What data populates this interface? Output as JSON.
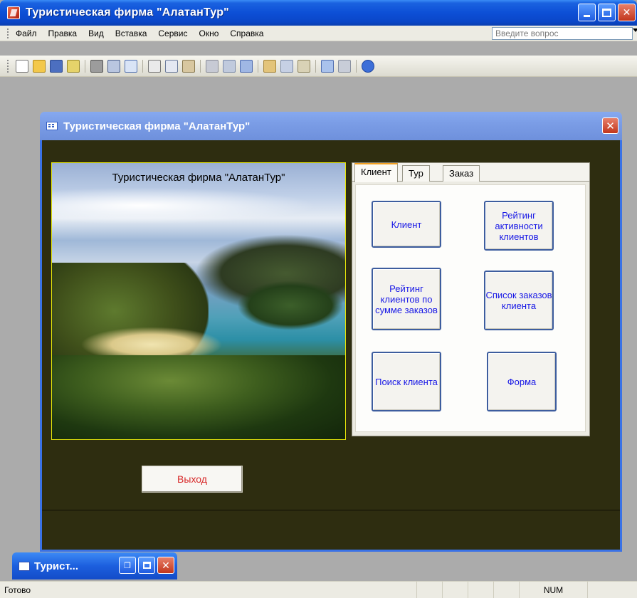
{
  "app": {
    "title": "Туристическая фирма \"АлатанТур\"",
    "accent": "#0d4fd6"
  },
  "menu": {
    "items": [
      "Файл",
      "Правка",
      "Вид",
      "Вставка",
      "Сервис",
      "Окно",
      "Справка"
    ],
    "ask_placeholder": "Введите вопрос"
  },
  "toolbar": {
    "icons": [
      "new-icon",
      "open-icon",
      "save-icon",
      "search-icon",
      "print-icon",
      "print-preview-icon",
      "spellcheck-icon",
      "cut-icon",
      "copy-icon",
      "paste-icon",
      "undo-icon",
      "insert-hyperlink-icon",
      "office-links-icon",
      "analyze-icon",
      "relationships-icon",
      "properties-icon",
      "new-object-icon",
      "help-icon"
    ]
  },
  "form": {
    "title": "Туристическая фирма \"АлатанТур\"",
    "picture_caption": "Туристическая фирма \"АлатанТур\"",
    "tabs": [
      "Клиент",
      "Тур",
      "Заказ"
    ],
    "active_tab": "Клиент",
    "buttons": [
      "Клиент",
      "Рейтинг активности клиентов",
      "Рейтинг клиентов по сумме заказов",
      "Список заказов клиента",
      "Поиск клиента",
      "Форма"
    ],
    "exit_label": "Выход",
    "colors": {
      "background": "#2e2d10",
      "button_text": "#1717e6",
      "exit_text": "#d82a2a"
    }
  },
  "minimized": {
    "title": "Турист..."
  },
  "status": {
    "text": "Готово",
    "num": "NUM"
  }
}
